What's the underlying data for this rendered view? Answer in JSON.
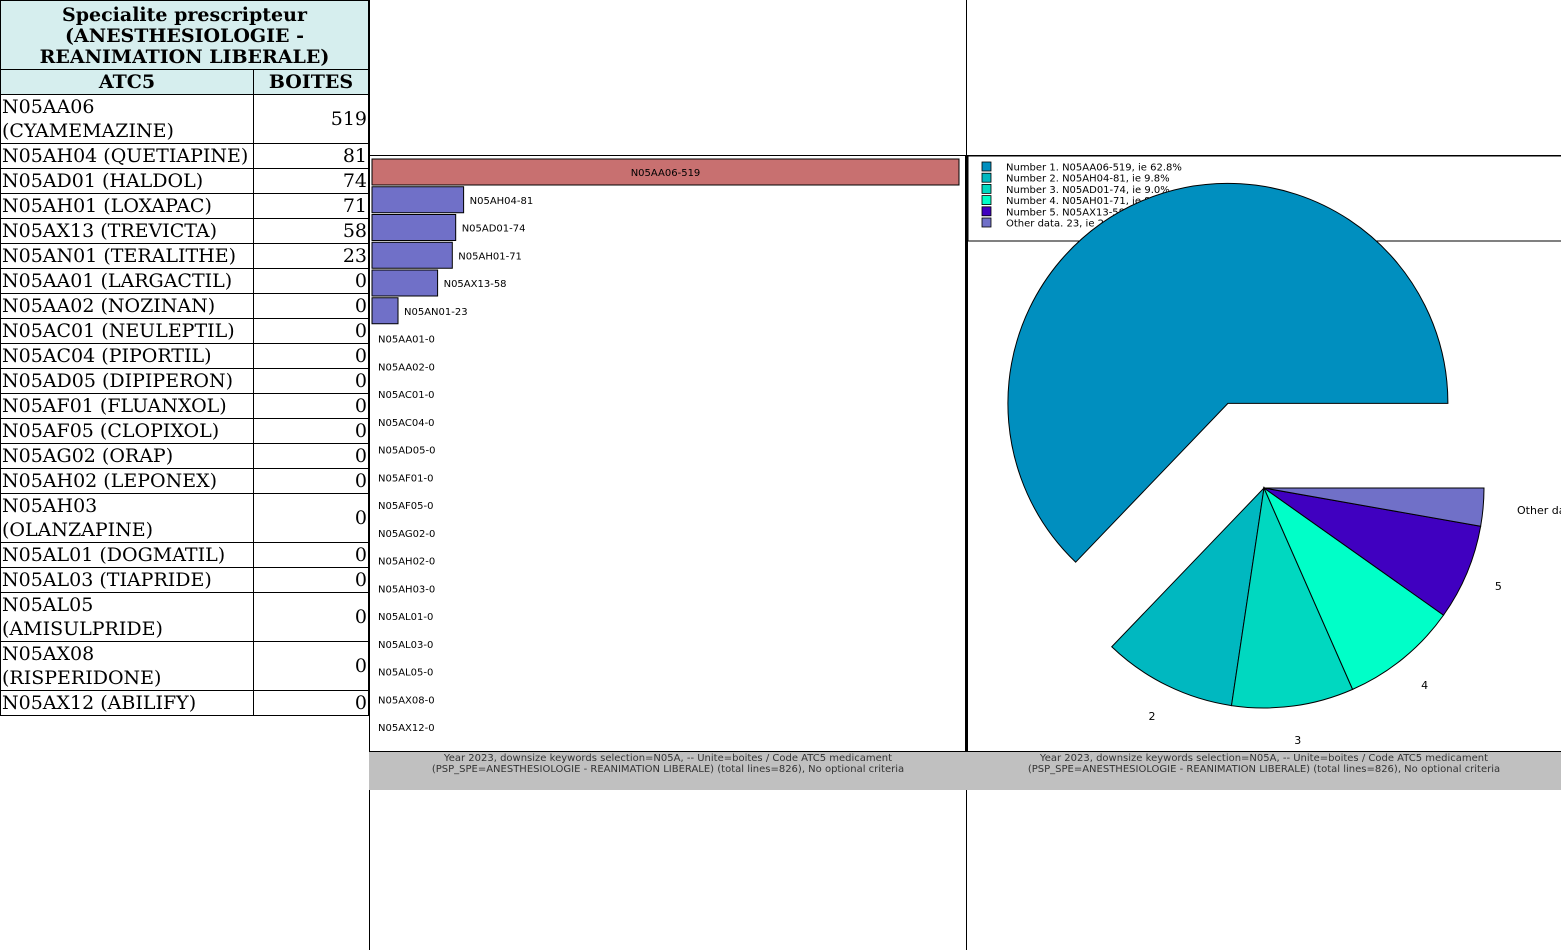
{
  "table": {
    "title_lines": [
      "Specialite prescripteur",
      "(ANESTHESIOLOGIE -",
      "REANIMATION LIBERALE)"
    ],
    "col_atc": "ATC5",
    "col_boites": "BOITES",
    "rows": [
      {
        "name": "N05AA06 (CYAMEMAZINE)",
        "value": "519"
      },
      {
        "name": "N05AH04 (QUETIAPINE)",
        "value": "81"
      },
      {
        "name": "N05AD01 (HALDOL)",
        "value": "74"
      },
      {
        "name": "N05AH01 (LOXAPAC)",
        "value": "71"
      },
      {
        "name": "N05AX13 (TREVICTA)",
        "value": "58"
      },
      {
        "name": "N05AN01 (TERALITHE)",
        "value": "23"
      },
      {
        "name": "N05AA01 (LARGACTIL)",
        "value": "0"
      },
      {
        "name": "N05AA02 (NOZINAN)",
        "value": "0"
      },
      {
        "name": "N05AC01 (NEULEPTIL)",
        "value": "0"
      },
      {
        "name": "N05AC04 (PIPORTIL)",
        "value": "0"
      },
      {
        "name": "N05AD05 (DIPIPERON)",
        "value": "0"
      },
      {
        "name": "N05AF01 (FLUANXOL)",
        "value": "0"
      },
      {
        "name": "N05AF05 (CLOPIXOL)",
        "value": "0"
      },
      {
        "name": "N05AG02 (ORAP)",
        "value": "0"
      },
      {
        "name": "N05AH02 (LEPONEX)",
        "value": "0"
      },
      {
        "name": "N05AH03 (OLANZAPINE)",
        "value": "0"
      },
      {
        "name": "N05AL01 (DOGMATIL)",
        "value": "0"
      },
      {
        "name": "N05AL03 (TIAPRIDE)",
        "value": "0"
      },
      {
        "name": "N05AL05 (AMISULPRIDE)",
        "value": "0"
      },
      {
        "name": "N05AX08 (RISPERIDONE)",
        "value": "0"
      },
      {
        "name": "N05AX12 (ABILIFY)",
        "value": "0"
      }
    ]
  },
  "caption": {
    "line1": "Year 2023, downsize keywords selection=N05A,  -- Unite=boites / Code ATC5 medicament",
    "line2": "(PSP_SPE=ANESTHESIOLOGIE - REANIMATION LIBERALE) (total lines=826), No optional criteria"
  },
  "chart_data": [
    {
      "type": "bar",
      "orientation": "horizontal",
      "categories": [
        "N05AA06",
        "N05AH04",
        "N05AD01",
        "N05AH01",
        "N05AX13",
        "N05AN01",
        "N05AA01",
        "N05AA02",
        "N05AC01",
        "N05AC04",
        "N05AD05",
        "N05AF01",
        "N05AF05",
        "N05AG02",
        "N05AH02",
        "N05AH03",
        "N05AL01",
        "N05AL03",
        "N05AL05",
        "N05AX08",
        "N05AX12"
      ],
      "values": [
        519,
        81,
        74,
        71,
        58,
        23,
        0,
        0,
        0,
        0,
        0,
        0,
        0,
        0,
        0,
        0,
        0,
        0,
        0,
        0,
        0
      ],
      "labels": [
        "N05AA06-519",
        "N05AH04-81",
        "N05AD01-74",
        "N05AH01-71",
        "N05AX13-58",
        "N05AN01-23",
        "N05AA01-0",
        "N05AA02-0",
        "N05AC01-0",
        "N05AC04-0",
        "N05AD05-0",
        "N05AF01-0",
        "N05AF05-0",
        "N05AG02-0",
        "N05AH02-0",
        "N05AH03-0",
        "N05AL01-0",
        "N05AL03-0",
        "N05AL05-0",
        "N05AX08-0",
        "N05AX12-0"
      ],
      "highlight_color": "#c87070",
      "bar_color": "#7070c8"
    },
    {
      "type": "pie",
      "values": [
        519,
        81,
        74,
        71,
        58,
        23
      ],
      "legend": [
        "Number 1. N05AA06-519, ie 62.8%",
        "Number 2. N05AH04-81, ie 9.8%",
        "Number 3. N05AD01-74, ie 9.0%",
        "Number 4. N05AH01-71, ie 8.6%",
        "Number 5. N05AX13-58, ie 7.0%",
        "Other data. 23, ie 2.8%"
      ],
      "slice_labels": [
        "",
        "2",
        "3",
        "4",
        "5",
        "Other da"
      ],
      "colors": [
        "#008fbf",
        "#00b8c0",
        "#00d8c0",
        "#00ffc8",
        "#4000c0",
        "#7070c8"
      ],
      "exploded_slice": 0,
      "legend_position": "top"
    }
  ]
}
